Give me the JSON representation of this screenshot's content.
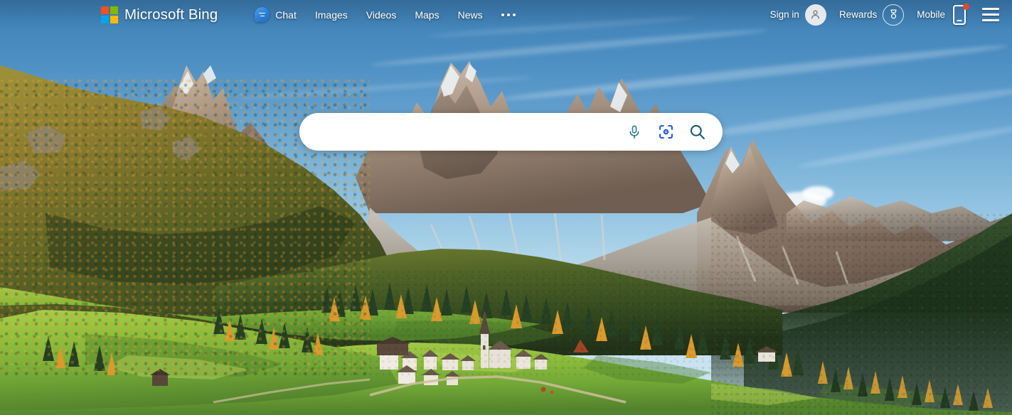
{
  "page": {
    "title": "Microsoft Bing",
    "background_description": "Autumn in Val di Funes, Dolomites, Italy - Santa Maddalena village church below the jagged Odle/Geisler peaks with golden larch forest and green meadows",
    "colors": {
      "sky_top": "#3e7fb4",
      "sky_bottom": "#c9e4f0",
      "rock": "#8a7668",
      "meadow_green": "#8fbe3c",
      "forest_dark": "#2a4426",
      "larch_gold": "#d9952c",
      "accent_blue": "#174ae0",
      "mic_teal": "#2e7d8f",
      "search_teal": "#17596b",
      "notification_red": "#e8482a"
    }
  },
  "header": {
    "brand": {
      "name": "Microsoft Bing",
      "logo_icon": "microsoft-logo-icon",
      "squares": [
        "#f25022",
        "#7fba00",
        "#00a4ef",
        "#ffb900"
      ]
    },
    "nav": [
      {
        "label": "Chat",
        "icon": "chat-bubble-icon",
        "name": "nav-chat"
      },
      {
        "label": "Images",
        "icon": "",
        "name": "nav-images"
      },
      {
        "label": "Videos",
        "icon": "",
        "name": "nav-videos"
      },
      {
        "label": "Maps",
        "icon": "",
        "name": "nav-maps"
      },
      {
        "label": "News",
        "icon": "",
        "name": "nav-news"
      }
    ],
    "more_menu": {
      "icon": "ellipsis-icon",
      "label": "More"
    },
    "right": {
      "sign_in": {
        "label": "Sign in",
        "icon": "person-avatar-icon"
      },
      "rewards": {
        "label": "Rewards",
        "icon": "rewards-medal-icon"
      },
      "mobile": {
        "label": "Mobile",
        "icon": "mobile-phone-icon",
        "badge": true
      },
      "hamburger": {
        "icon": "hamburger-menu-icon",
        "label": "Settings and quick links"
      }
    }
  },
  "search": {
    "value": "",
    "placeholder": "",
    "icons": [
      {
        "name": "microphone-icon",
        "label": "Search using voice"
      },
      {
        "name": "visual-search-icon",
        "label": "Search using an image"
      },
      {
        "name": "search-icon",
        "label": "Search"
      }
    ]
  }
}
